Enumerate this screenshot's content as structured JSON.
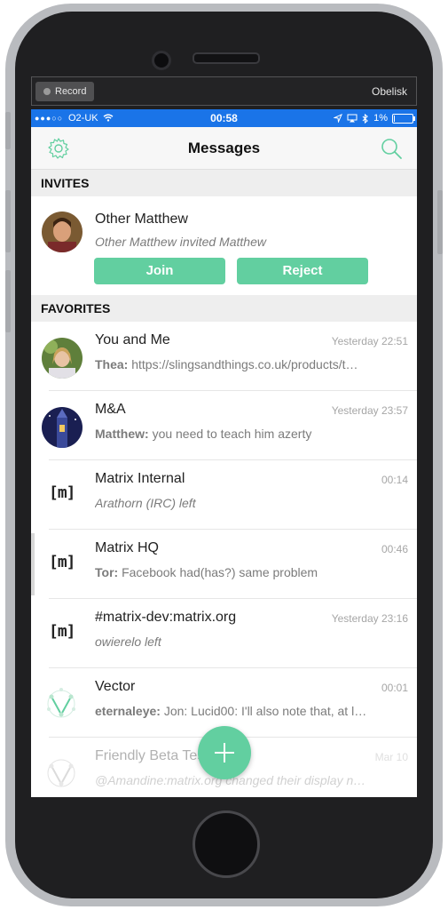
{
  "record_bar": {
    "record_label": "Record",
    "device_name": "Obelisk"
  },
  "statusbar": {
    "signal": "●●●○○",
    "carrier": "O2-UK",
    "time": "00:58",
    "battery": "1%"
  },
  "navbar": {
    "title": "Messages"
  },
  "sections": {
    "invites": "INVITES",
    "favorites": "FAVORITES"
  },
  "invite": {
    "name": "Other Matthew",
    "preview": "Other Matthew invited Matthew",
    "join_label": "Join",
    "reject_label": "Reject"
  },
  "rooms": [
    {
      "name": "You and Me",
      "time": "Yesterday 22:51",
      "sender": "Thea:",
      "text": "https://slingsandthings.co.uk/products/t…"
    },
    {
      "name": "M&A",
      "time": "Yesterday 23:57",
      "sender": "Matthew:",
      "text": "you need to teach him azerty"
    },
    {
      "name": "Matrix Internal",
      "time": "00:14",
      "sender": "",
      "text": "Arathorn (IRC) left"
    },
    {
      "name": "Matrix HQ",
      "time": "00:46",
      "sender": "Tor:",
      "text": "Facebook had(has?) same problem"
    },
    {
      "name": "#matrix-dev:matrix.org",
      "time": "Yesterday 23:16",
      "sender": "",
      "text": "owierelo left"
    },
    {
      "name": "Vector",
      "time": "00:01",
      "sender": "eternaleye:",
      "text": "Jon: Lucid00: I'll also note that, at l…"
    },
    {
      "name": "Friendly Beta Testers",
      "time": "Mar 10",
      "sender": "",
      "text": "@Amandine:matrix.org changed their display n…"
    }
  ],
  "matrix_logo_text": "[m]",
  "colors": {
    "accent": "#62cfa0",
    "statusbar": "#1a74e8"
  }
}
